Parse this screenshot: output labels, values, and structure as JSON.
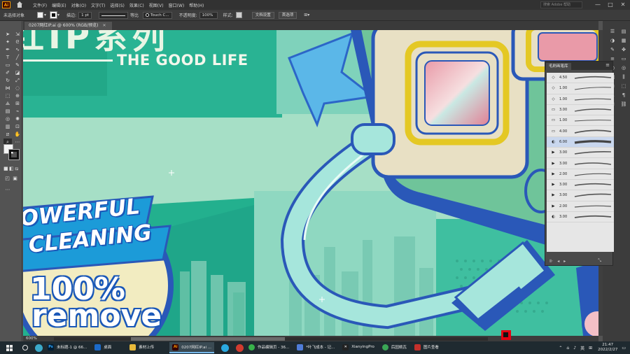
{
  "menubar": {
    "items": [
      "文件(F)",
      "编辑(E)",
      "对象(O)",
      "文字(T)",
      "选择(S)",
      "效果(C)",
      "视图(V)",
      "窗口(W)",
      "帮助(H)"
    ],
    "search_placeholder": "搜索 Adobe 帮助",
    "window_buttons": [
      "—",
      "□",
      "✕"
    ]
  },
  "controlbar": {
    "selection_label": "未选择对象",
    "stroke_label": "描边:",
    "stroke_value": "1 pt",
    "stroke_style": "等比",
    "brush_name": "Touch C...",
    "opacity_label": "不透明度:",
    "opacity_value": "100%",
    "style_label": "样式:",
    "doc_setup": "文档设置",
    "preferences": "首选项"
  },
  "document": {
    "tab_title": "0207网红IP.ai @ 600% (RGB/预览)",
    "zoom": "600%",
    "artwork_text": {
      "title_cn": "红IP系列",
      "good_life": "THE GOOD LIFE",
      "powerful": "OWERFUL",
      "cleaning": "CLEANING",
      "percent": "100%",
      "remove": "remove"
    }
  },
  "brushes_panel": {
    "title": "毛刷画笔库",
    "brushes": [
      {
        "icon": "◇",
        "size": "4.50"
      },
      {
        "icon": "◇",
        "size": "1.00"
      },
      {
        "icon": "◇",
        "size": "1.00"
      },
      {
        "icon": "▭",
        "size": "3.00"
      },
      {
        "icon": "▭",
        "size": "1.00"
      },
      {
        "icon": "▭",
        "size": "4.00"
      },
      {
        "icon": "◐",
        "size": "6.00"
      },
      {
        "icon": "▶",
        "size": "3.00"
      },
      {
        "icon": "▶",
        "size": "3.00"
      },
      {
        "icon": "▶",
        "size": "2.00"
      },
      {
        "icon": "▶",
        "size": "3.00"
      },
      {
        "icon": "▶",
        "size": "3.00"
      },
      {
        "icon": "▶",
        "size": "2.00"
      },
      {
        "icon": "◐",
        "size": "3.00"
      }
    ]
  },
  "taskbar": {
    "tasks": [
      {
        "icon": "Ps",
        "color": "#31a8ff",
        "bg": "#001e36",
        "label": "未标题-1 @ 66..."
      },
      {
        "icon": "",
        "color": "#ffffff",
        "bg": "#1b6ac9",
        "label": "桌面"
      },
      {
        "icon": "",
        "color": "#ffffff",
        "bg": "#e8b93a",
        "label": "素材上传"
      },
      {
        "icon": "Ai",
        "color": "#ff9a00",
        "bg": "#330000",
        "label": "0207网红IP.ai ..."
      },
      {
        "icon": "",
        "color": "#ffffff",
        "bg": "#2aa9e0",
        "label": ""
      },
      {
        "icon": "",
        "color": "#ffffff",
        "bg": "#d23b2f",
        "label": ""
      },
      {
        "icon": "",
        "color": "#ffffff",
        "bg": "#38b24a",
        "label": "作品编辑页 - 36..."
      },
      {
        "icon": "",
        "color": "#ffffff",
        "bg": "#4f7cd8",
        "label": "*叶飞成本 - 记..."
      },
      {
        "icon": "",
        "color": "#ffffff",
        "bg": "#222222",
        "label": "XianyingPro"
      },
      {
        "icon": "",
        "color": "#ffffff",
        "bg": "#3aa655",
        "label": "后园桃瓦"
      },
      {
        "icon": "",
        "color": "#ffffff",
        "bg": "#c4302b",
        "label": "图片查看"
      }
    ],
    "ime": "英",
    "time": "21:47",
    "date": "2022/2/27"
  }
}
